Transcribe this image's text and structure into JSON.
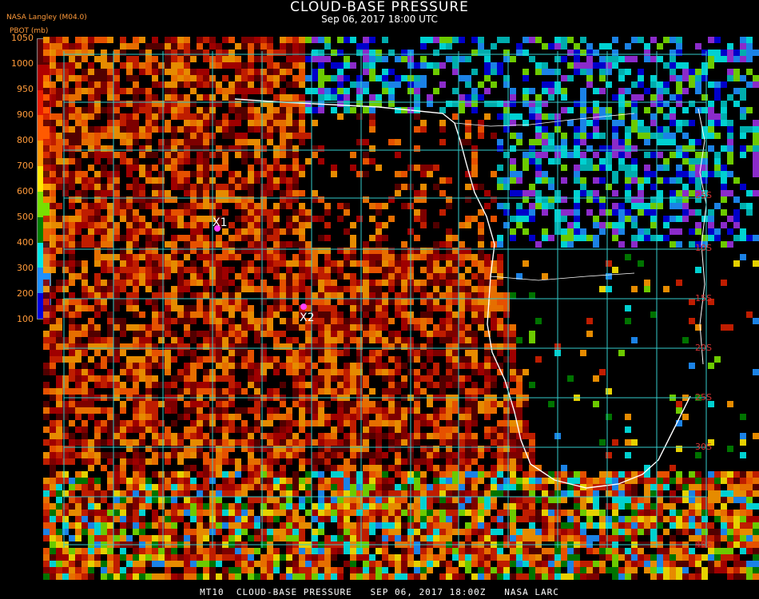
{
  "header": {
    "title": "CLOUD-BASE PRESSURE",
    "subtitle": "Sep 06, 2017 18:00 UTC",
    "provider": "NASA Langley (M04.0)"
  },
  "legend": {
    "title": "PBOT (mb)",
    "labels": [
      "1050",
      "1000",
      "950",
      "900",
      "800",
      "700",
      "600",
      "500",
      "400",
      "300",
      "200",
      "100"
    ],
    "colors": [
      "#5a0000",
      "#b00000",
      "#e81c00",
      "#ff5a00",
      "#ff9a00",
      "#ffe800",
      "#78e000",
      "#008000",
      "#00e8e8",
      "#1e90ff",
      "#0000e0",
      "#9a30e0"
    ]
  },
  "map": {
    "latitude_labels": [
      "25S",
      "10S",
      "15S",
      "20S",
      "25S",
      "30S",
      "40S"
    ],
    "markers": [
      {
        "label": "X1",
        "color": "#ff40ff"
      },
      {
        "label": "X2",
        "color": "#ff40ff"
      }
    ],
    "grid_color": "#33cccc",
    "coast_color": "#ffffff"
  },
  "footer": {
    "text": "MT10  CLOUD-BASE PRESSURE   SEP 06, 2017 18:00Z   NASA LARC"
  }
}
